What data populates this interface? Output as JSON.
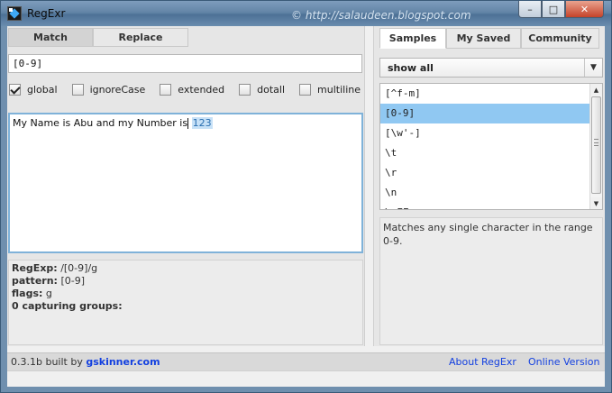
{
  "window": {
    "title": "RegExr",
    "watermark": "© http://salaudeen.blogspot.com",
    "buttons": {
      "minimize": "–",
      "maximize": "□",
      "close": "✕"
    }
  },
  "left": {
    "tabs": [
      {
        "label": "Match",
        "active": true
      },
      {
        "label": "Replace",
        "active": false
      }
    ],
    "pattern": "[0-9]",
    "flags": [
      {
        "label": "global",
        "checked": true
      },
      {
        "label": "ignoreCase",
        "checked": false
      },
      {
        "label": "extended",
        "checked": false
      },
      {
        "label": "dotall",
        "checked": false
      },
      {
        "label": "multiline",
        "checked": false
      }
    ],
    "source_text": {
      "before": "My Name is Abu and my Number is",
      "between": " ",
      "match": "123"
    },
    "results": {
      "regexp_label": "RegExp:",
      "regexp_value": "/[0-9]/g",
      "pattern_label": "pattern:",
      "pattern_value": "[0-9]",
      "flags_label": "flags:",
      "flags_value": "g",
      "groups_label": "0 capturing groups:"
    }
  },
  "right": {
    "tabs": [
      {
        "label": "Samples",
        "active": true
      },
      {
        "label": "My Saved",
        "active": false
      },
      {
        "label": "Community",
        "active": false
      }
    ],
    "filter": "show all",
    "samples": [
      {
        "label": "[^f-m]",
        "selected": false
      },
      {
        "label": "[0-9]",
        "selected": true
      },
      {
        "label": "[\\w'-]",
        "selected": false
      },
      {
        "label": "\\t",
        "selected": false
      },
      {
        "label": "\\r",
        "selected": false
      },
      {
        "label": "\\n",
        "selected": false
      },
      {
        "label": "\\xFF",
        "selected": false
      }
    ],
    "description": "Matches any single character in the range 0-9."
  },
  "footer": {
    "version": "0.3.1b built by",
    "author": "gskinner.com",
    "about": "About RegExr",
    "online": "Online Version"
  }
}
